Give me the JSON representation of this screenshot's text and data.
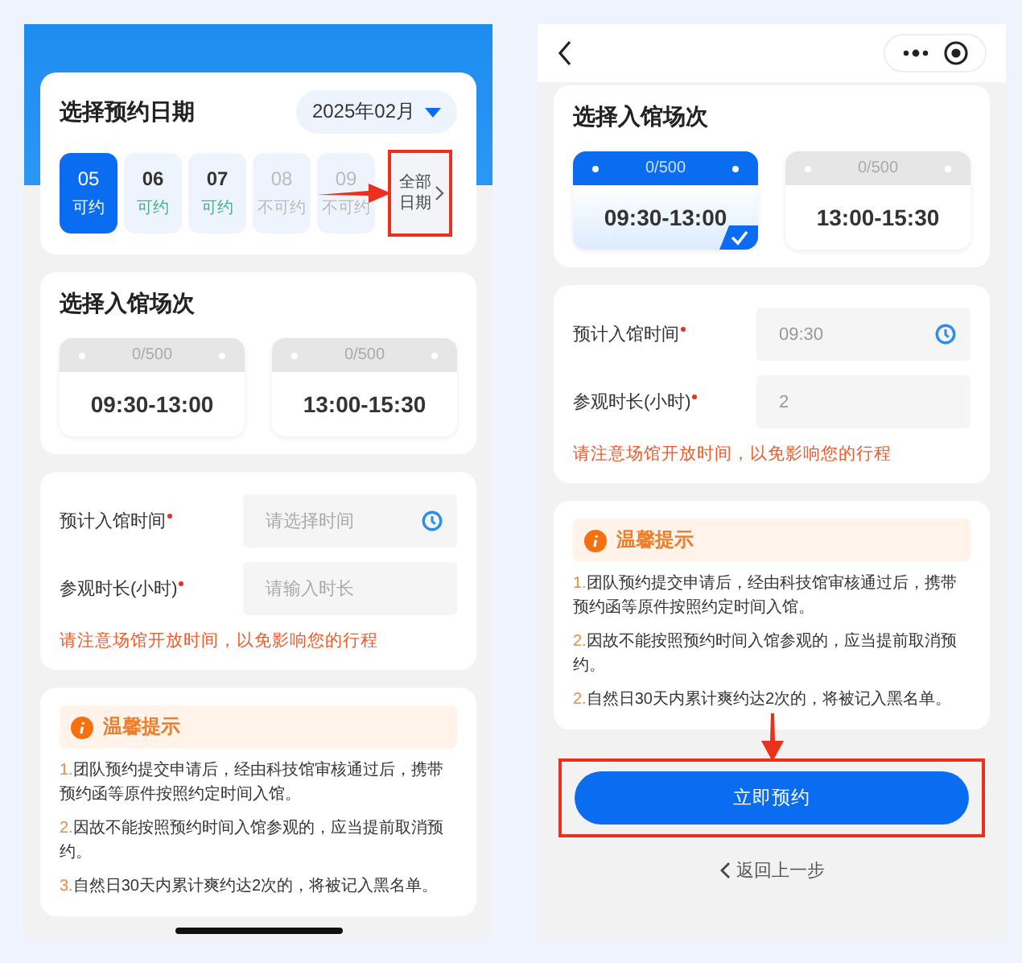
{
  "left": {
    "date_card": {
      "title": "选择预约日期",
      "month": "2025年02月",
      "days": [
        {
          "day": "05",
          "status": "可约",
          "available": true,
          "selected": true
        },
        {
          "day": "06",
          "status": "可约",
          "available": true,
          "selected": false
        },
        {
          "day": "07",
          "status": "可约",
          "available": true,
          "selected": false
        },
        {
          "day": "08",
          "status": "不可约",
          "available": false,
          "selected": false
        },
        {
          "day": "09",
          "status": "不可约",
          "available": false,
          "selected": false
        }
      ],
      "all_dates": {
        "label_lines": [
          "全部",
          "日期"
        ],
        "highlighted": true
      }
    },
    "session_card": {
      "title": "选择入馆场次",
      "sessions": [
        {
          "capacity": "0/500",
          "time": "09:30-13:00",
          "selected": false
        },
        {
          "capacity": "0/500",
          "time": "13:00-15:30",
          "selected": false
        }
      ]
    },
    "form": {
      "fields": [
        {
          "label": "预计入馆时间",
          "required": true,
          "placeholder": "请选择时间",
          "kind": "time"
        },
        {
          "label": "参观时长(小时)",
          "required": true,
          "placeholder": "请输入时长",
          "kind": "text"
        }
      ],
      "notice": "请注意场馆开放时间，以免影响您的行程"
    },
    "tips": {
      "title": "温馨提示",
      "items": [
        {
          "number": "1.",
          "text": "团队预约提交申请后，经由科技馆审核通过后，携带预约函等原件按照约定时间入馆。"
        },
        {
          "number": "2.",
          "text": "因故不能按照预约时间入馆参观的，应当提前取消预约。"
        },
        {
          "number": "3.",
          "text": "自然日30天内累计爽约达2次的，将被记入黑名单。"
        }
      ]
    }
  },
  "right": {
    "session_card": {
      "title": "选择入馆场次",
      "sessions": [
        {
          "capacity": "0/500",
          "time": "09:30-13:00",
          "selected": true
        },
        {
          "capacity": "0/500",
          "time": "13:00-15:30",
          "selected": false
        }
      ]
    },
    "form": {
      "fields": [
        {
          "label": "预计入馆时间",
          "required": true,
          "value": "09:30",
          "kind": "time"
        },
        {
          "label": "参观时长(小时)",
          "required": true,
          "value": "2",
          "kind": "text"
        }
      ],
      "notice": "请注意场馆开放时间，以免影响您的行程"
    },
    "tips": {
      "title": "温馨提示",
      "items": [
        {
          "number": "1.",
          "text": "团队预约提交申请后，经由科技馆审核通过后，携带预约函等原件按照约定时间入馆。"
        },
        {
          "number": "2.",
          "text": "因故不能按照预约时间入馆参观的，应当提前取消预约。"
        },
        {
          "number": "2.",
          "text": "自然日30天内累计爽约达2次的，将被记入黑名单。"
        }
      ]
    },
    "submit_button": {
      "label": "立即预约",
      "highlighted": true
    },
    "back_link": "返回上一步"
  }
}
